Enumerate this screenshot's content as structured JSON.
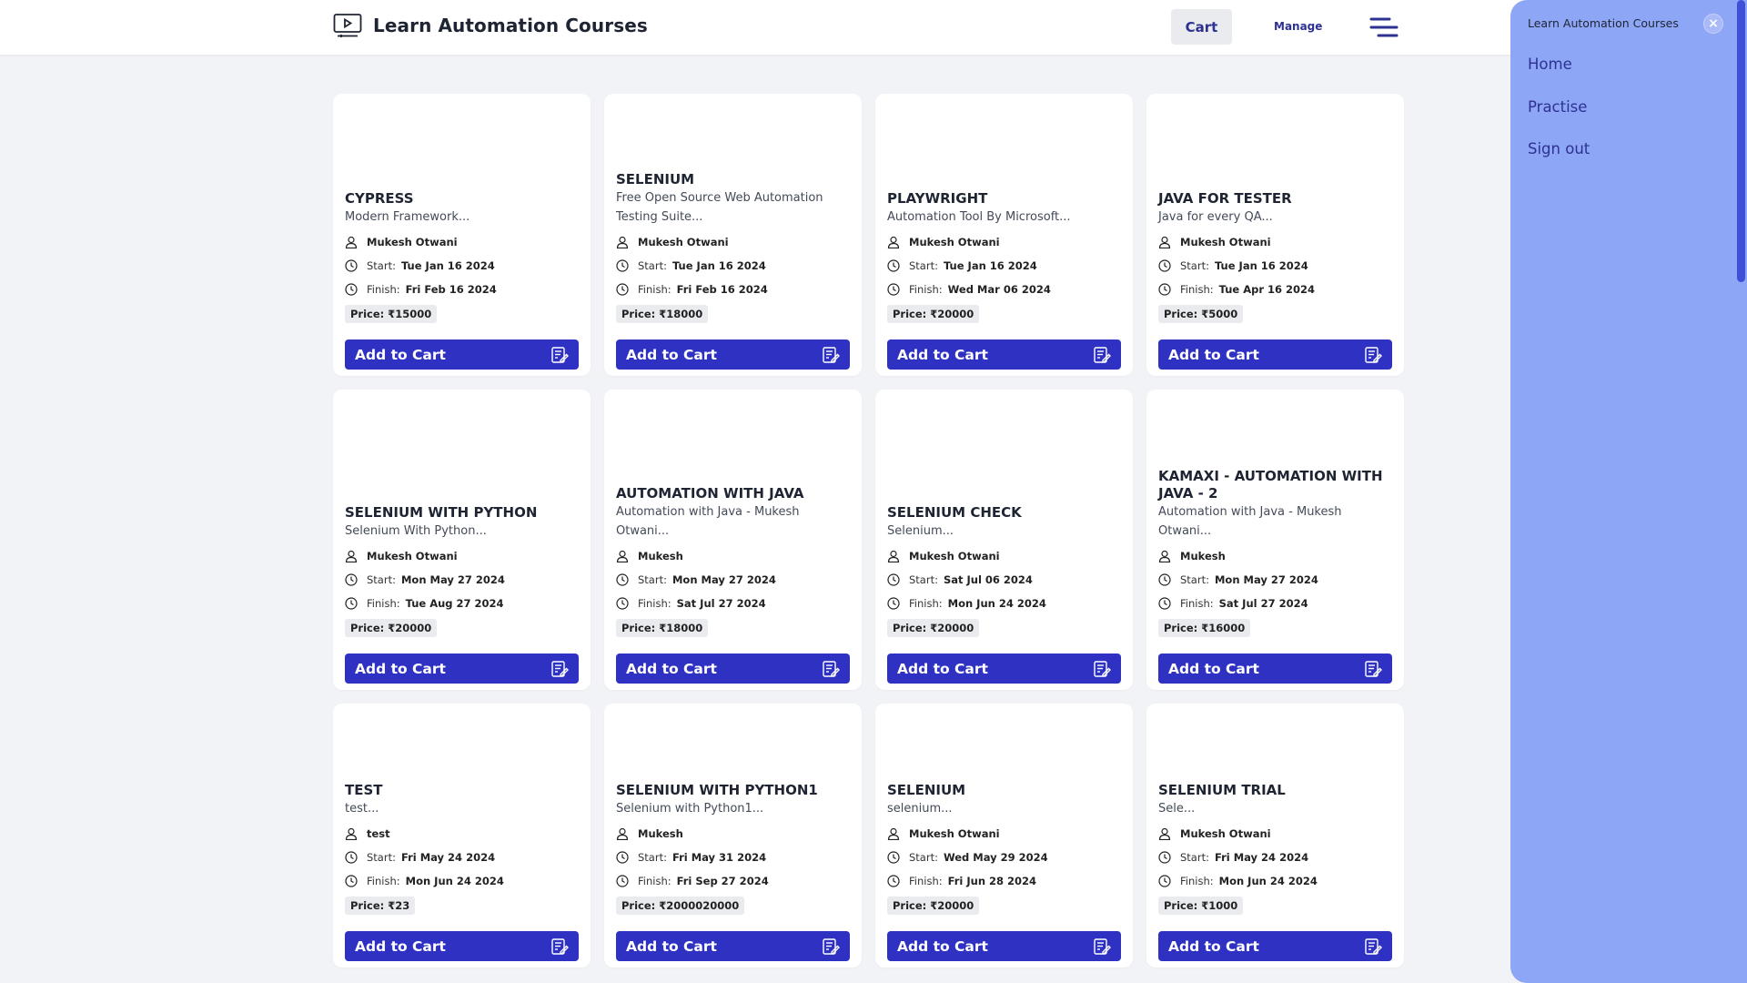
{
  "header": {
    "title": "Learn Automation Courses",
    "cart_label": "Cart",
    "manage_label": "Manage"
  },
  "courses": [
    {
      "title": "CYPRESS",
      "desc": "Modern Framework...",
      "author": "Mukesh Otwani",
      "start": "Tue Jan 16 2024",
      "finish": "Fri Feb 16 2024",
      "price": "Price: ₹15000"
    },
    {
      "title": "SELENIUM",
      "desc": "Free Open Source Web Automation Testing Suite...",
      "author": "Mukesh Otwani",
      "start": "Tue Jan 16 2024",
      "finish": "Fri Feb 16 2024",
      "price": "Price: ₹18000"
    },
    {
      "title": "PLAYWRIGHT",
      "desc": "Automation Tool By Microsoft...",
      "author": "Mukesh Otwani",
      "start": "Tue Jan 16 2024",
      "finish": "Wed Mar 06 2024",
      "price": "Price: ₹20000"
    },
    {
      "title": "JAVA FOR TESTER",
      "desc": "Java for every QA...",
      "author": "Mukesh Otwani",
      "start": "Tue Jan 16 2024",
      "finish": "Tue Apr 16 2024",
      "price": "Price: ₹5000"
    },
    {
      "title": "SELENIUM WITH PYTHON",
      "desc": "Selenium With Python...",
      "author": "Mukesh Otwani",
      "start": "Mon May 27 2024",
      "finish": "Tue Aug 27 2024",
      "price": "Price: ₹20000"
    },
    {
      "title": "AUTOMATION WITH JAVA",
      "desc": "Automation with Java - Mukesh Otwani...",
      "author": "Mukesh",
      "start": "Mon May 27 2024",
      "finish": "Sat Jul 27 2024",
      "price": "Price: ₹18000"
    },
    {
      "title": "SELENIUM CHECK",
      "desc": "Selenium...",
      "author": "Mukesh Otwani",
      "start": "Sat Jul 06 2024",
      "finish": "Mon Jun 24 2024",
      "price": "Price: ₹20000"
    },
    {
      "title": "KAMAXI - AUTOMATION WITH JAVA - 2",
      "desc": "Automation with Java - Mukesh Otwani...",
      "author": "Mukesh",
      "start": "Mon May 27 2024",
      "finish": "Sat Jul 27 2024",
      "price": "Price: ₹16000"
    },
    {
      "title": "TEST",
      "desc": "test...",
      "author": "test",
      "start": "Fri May 24 2024",
      "finish": "Mon Jun 24 2024",
      "price": "Price: ₹23"
    },
    {
      "title": "SELENIUM WITH PYTHON1",
      "desc": "Selenium with Python1...",
      "author": "Mukesh",
      "start": "Fri May 31 2024",
      "finish": "Fri Sep 27 2024",
      "price": "Price: ₹2000020000"
    },
    {
      "title": "SELENIUM",
      "desc": "selenium...",
      "author": "Mukesh Otwani",
      "start": "Wed May 29 2024",
      "finish": "Fri Jun 28 2024",
      "price": "Price: ₹20000"
    },
    {
      "title": "SELENIUM TRIAL",
      "desc": "Sele...",
      "author": "Mukesh Otwani",
      "start": "Fri May 24 2024",
      "finish": "Mon Jun 24 2024",
      "price": "Price: ₹1000"
    }
  ],
  "card_labels": {
    "start": "Start:",
    "finish": "Finish:",
    "add_to_cart": "Add to Cart"
  },
  "sidebar": {
    "title": "Learn Automation Courses",
    "items": [
      "Home",
      "Practise",
      "Sign out"
    ]
  },
  "icons": {
    "brand": "monitor-play-icon",
    "menu": "hamburger-menu-icon",
    "author": "user-icon",
    "date": "clock-icon",
    "cart": "note-edit-icon",
    "close": "close-icon"
  },
  "colors": {
    "primary_button": "#2e31c2",
    "brand_text": "#2e3192",
    "sidebar_bg": "#8ea6f6",
    "page_bg": "#f2f3f6"
  }
}
